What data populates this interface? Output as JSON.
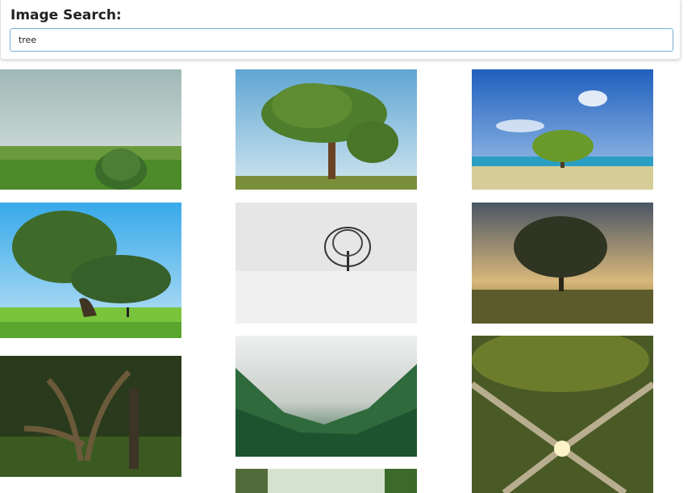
{
  "search": {
    "heading": "Image Search:",
    "query": "tree",
    "placeholder": ""
  },
  "results": [
    {
      "name": "result-image-tree-meadow",
      "col": 0,
      "row": 0
    },
    {
      "name": "result-image-umbrella-tree-sky",
      "col": 1,
      "row": 0
    },
    {
      "name": "result-image-tree-beach",
      "col": 2,
      "row": 0
    },
    {
      "name": "result-image-wide-tree-hill",
      "col": 0,
      "row": 1
    },
    {
      "name": "result-image-bare-tree-snow",
      "col": 1,
      "row": 1
    },
    {
      "name": "result-image-tree-sunrise-mist",
      "col": 2,
      "row": 1
    },
    {
      "name": "result-image-forest-banyan",
      "col": 0,
      "row": 2
    },
    {
      "name": "result-image-misty-forest-valley",
      "col": 1,
      "row": 2
    },
    {
      "name": "result-image-tree-canopy-from-below",
      "col": 2,
      "row": 2
    },
    {
      "name": "result-image-forest-canopy-partial",
      "col": 1,
      "row": 3
    }
  ]
}
